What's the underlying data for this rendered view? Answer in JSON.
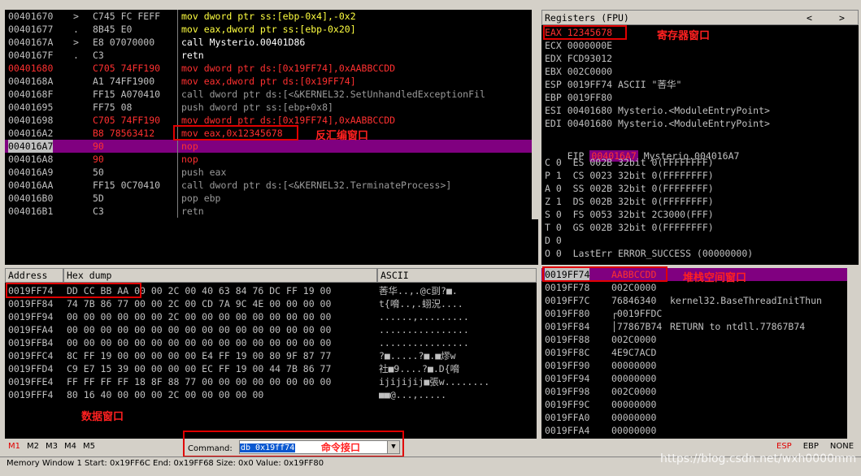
{
  "disasm": {
    "rows": [
      {
        "addr": "00401670",
        "mark": ">",
        "hex": "C745 FC FEFF",
        "asm": "mov dword ptr ss:[ebp-0x4],-0x2"
      },
      {
        "addr": "00401677",
        "mark": ".",
        "hex": "8B45 E0",
        "asm": "mov eax,dword ptr ss:[ebp-0x20]"
      },
      {
        "addr": "0040167A",
        "mark": ">",
        "hex": "E8 07070000",
        "asm": "call Mysterio.00401D86"
      },
      {
        "addr": "0040167F",
        "mark": ".",
        "hex": "C3",
        "asm": "retn"
      },
      {
        "addr": "00401680",
        "mark": "",
        "hex": "C705 74FF190",
        "asm": "mov dword ptr ds:[0x19FF74],0xAABBCCDD"
      },
      {
        "addr": "0040168A",
        "mark": "",
        "hex": "A1 74FF1900",
        "asm": "mov eax,dword ptr ds:[0x19FF74]"
      },
      {
        "addr": "0040168F",
        "mark": "",
        "hex": "FF15 A070410",
        "asm": "call dword ptr ds:[<&KERNEL32.SetUnhandledExceptionFil"
      },
      {
        "addr": "00401695",
        "mark": "",
        "hex": "FF75 08",
        "asm": "push dword ptr ss:[ebp+0x8]"
      },
      {
        "addr": "00401698",
        "mark": "",
        "hex": "C705 74FF190",
        "asm": "mov dword ptr ds:[0x19FF74],0xAABBCCDD"
      },
      {
        "addr": "004016A2",
        "mark": "",
        "hex": "B8 78563412",
        "asm": "mov eax,0x12345678"
      },
      {
        "addr": "004016A7",
        "mark": "",
        "hex": "90",
        "asm": "nop"
      },
      {
        "addr": "004016A8",
        "mark": "",
        "hex": "90",
        "asm": "nop"
      },
      {
        "addr": "004016A9",
        "mark": "",
        "hex": "50",
        "asm": "push eax"
      },
      {
        "addr": "004016AA",
        "mark": "",
        "hex": "FF15 0C70410",
        "asm": "call dword ptr ds:[<&KERNEL32.TerminateProcess>]"
      },
      {
        "addr": "004016B0",
        "mark": "",
        "hex": "5D",
        "asm": "pop ebp"
      },
      {
        "addr": "004016B1",
        "mark": "",
        "hex": "C3",
        "asm": "retn"
      }
    ],
    "annotation": "反汇编窗口"
  },
  "registers": {
    "title": "Registers (FPU)",
    "nav_left": "<",
    "nav_right": ">",
    "lines": [
      "EAX 12345678",
      "ECX 0000000E",
      "EDX FCD93012",
      "EBX 002C0000",
      "ESP 0019FF74 ASCII \"莕华\"",
      "EBP 0019FF80",
      "ESI 00401680 Mysterio.<ModuleEntryPoint>",
      "EDI 00401680 Mysterio.<ModuleEntryPoint>"
    ],
    "eip_label": "EIP",
    "eip_value": "004016A7",
    "eip_desc": "Mysterio.004016A7",
    "flags": [
      "C 0  ES 002B 32bit 0(FFFFFFFF)",
      "P 1  CS 0023 32bit 0(FFFFFFFF)",
      "A 0  SS 002B 32bit 0(FFFFFFFF)",
      "Z 1  DS 002B 32bit 0(FFFFFFFF)",
      "S 0  FS 0053 32bit 2C3000(FFF)",
      "T 0  GS 002B 32bit 0(FFFFFFFF)",
      "D 0",
      "O 0  LastErr ERROR_SUCCESS (00000000)"
    ],
    "annotation": "寄存器窗口"
  },
  "dump": {
    "col_address": "Address",
    "col_hex": "Hex dump",
    "col_ascii": "ASCII",
    "rows": [
      {
        "addr": "0019FF74",
        "hex": "DD CC BB AA 00 00 2C 00 40 63 84 76 DC FF 19 00",
        "ascii": "莕华..,.@c刯?■."
      },
      {
        "addr": "0019FF84",
        "hex": "74 7B 86 77 00 00 2C 00 CD 7A 9C 4E 00 00 00 00",
        "ascii": "t{嗋..,.蛡況...."
      },
      {
        "addr": "0019FF94",
        "hex": "00 00 00 00 00 00 2C 00 00 00 00 00 00 00 00 00",
        "ascii": "......,........."
      },
      {
        "addr": "0019FFA4",
        "hex": "00 00 00 00 00 00 00 00 00 00 00 00 00 00 00 00",
        "ascii": "................"
      },
      {
        "addr": "0019FFB4",
        "hex": "00 00 00 00 00 00 00 00 00 00 00 00 00 00 00 00",
        "ascii": "................"
      },
      {
        "addr": "0019FFC4",
        "hex": "8C FF 19 00 00 00 00 00 E4 FF 19 00 80 9F 87 77",
        "ascii": "?■.....?■.■熮w"
      },
      {
        "addr": "0019FFD4",
        "hex": "C9 E7 15 39 00 00 00 00 EC FF 19 00 44 7B 86 77",
        "ascii": "社■9....?■.D{嗋"
      },
      {
        "addr": "0019FFE4",
        "hex": "FF FF FF FF 18 8F 88 77 00 00 00 00 00 00 00 00",
        "ascii": "ijijijij■張w........"
      },
      {
        "addr": "0019FFF4",
        "hex": "80 16 40 00 00 00 2C 00 00 00 00 00",
        "ascii": "■■@...,....."
      }
    ],
    "annotation": "数据窗口"
  },
  "stack": {
    "rows": [
      {
        "addr": "0019FF74",
        "val": "AABBCCDD",
        "cmt": ""
      },
      {
        "addr": "0019FF78",
        "val": "002C0000",
        "cmt": ""
      },
      {
        "addr": "0019FF7C",
        "val": "76846340",
        "cmt": "kernel32.BaseThreadInitThun"
      },
      {
        "addr": "0019FF80",
        "val": "┌0019FFDC",
        "cmt": ""
      },
      {
        "addr": "0019FF84",
        "val": "│77867B74",
        "cmt": "RETURN to ntdll.77867B74"
      },
      {
        "addr": "0019FF88",
        "val": "002C0000",
        "cmt": ""
      },
      {
        "addr": "0019FF8C",
        "val": "4E9C7ACD",
        "cmt": ""
      },
      {
        "addr": "0019FF90",
        "val": "00000000",
        "cmt": ""
      },
      {
        "addr": "0019FF94",
        "val": "00000000",
        "cmt": ""
      },
      {
        "addr": "0019FF98",
        "val": "002C0000",
        "cmt": ""
      },
      {
        "addr": "0019FF9C",
        "val": "00000000",
        "cmt": ""
      },
      {
        "addr": "0019FFA0",
        "val": "00000000",
        "cmt": ""
      },
      {
        "addr": "0019FFA4",
        "val": "00000000",
        "cmt": ""
      }
    ],
    "annotation": "堆栈空间窗口"
  },
  "bottom": {
    "tabs": [
      "M1",
      "M2",
      "M3",
      "M4",
      "M5"
    ],
    "command_label": "Command:",
    "command_value": "db 0x19ff74",
    "command_annotation": "命令接口",
    "right_btns": [
      "ESP",
      "EBP",
      "NONE"
    ],
    "status": "Memory Window 1  Start: 0x19FF6C  End: 0x19FF68  Size: 0x0 Value: 0x19FF80",
    "watermark": "https://blog.csdn.net/wxh0000mm"
  },
  "colors": {
    "red": "#ff3030",
    "sel": "#800080",
    "accent": "#e00000"
  }
}
